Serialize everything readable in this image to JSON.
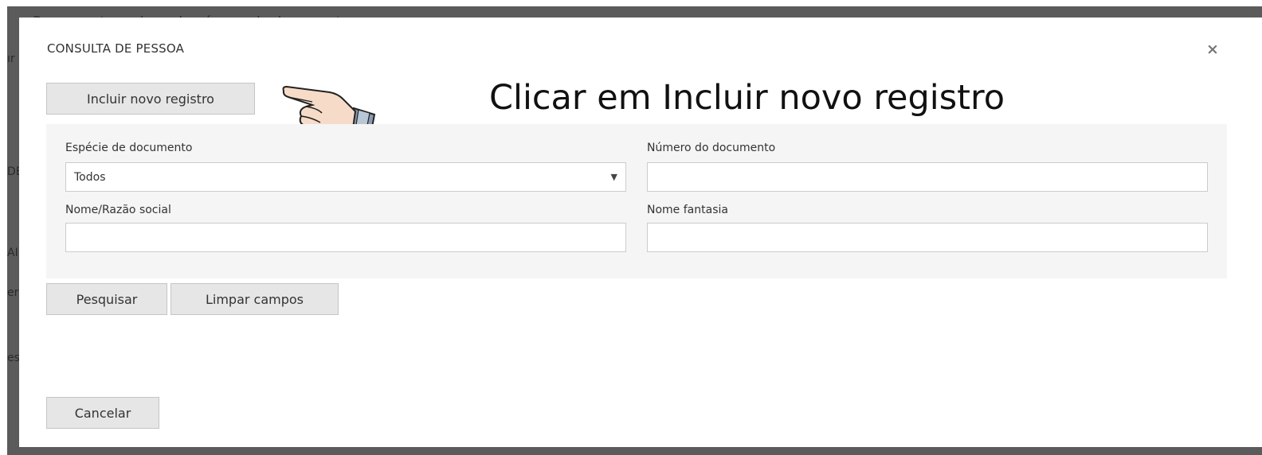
{
  "background": {
    "top_text": "Busque o tomador pelo número do documento ou nome",
    "fragments": [
      "ır",
      "DE",
      "AI",
      "er",
      "es"
    ]
  },
  "modal": {
    "title": "CONSULTA DE PESSOA",
    "close_icon": "×"
  },
  "annotation": {
    "text": "Clicar em Incluir novo registro",
    "pointer_icon": "pointing-hand"
  },
  "buttons": {
    "include_new": "Incluir novo registro",
    "search": "Pesquisar",
    "clear": "Limpar campos",
    "cancel": "Cancelar"
  },
  "filters": {
    "document_type": {
      "label": "Espécie de documento",
      "value": "Todos"
    },
    "document_number": {
      "label": "Número do documento",
      "value": ""
    },
    "name": {
      "label": "Nome/Razão social",
      "value": ""
    },
    "trade_name": {
      "label": "Nome fantasia",
      "value": ""
    }
  }
}
